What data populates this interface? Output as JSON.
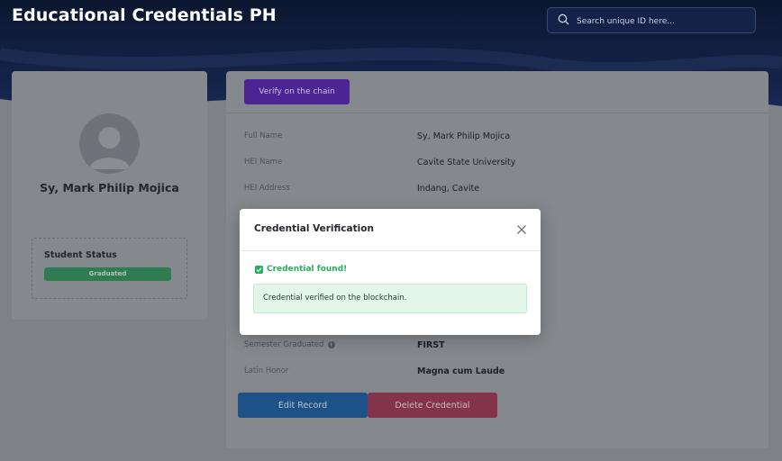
{
  "app": {
    "title": "Educational Credentials PH"
  },
  "search": {
    "placeholder": "Search unique ID here..."
  },
  "profile": {
    "name": "Sy, Mark Philip Mojica",
    "status_label": "Student Status",
    "status_value": "Graduated"
  },
  "actions": {
    "verify_label": "Verify on the chain",
    "edit_label": "Edit Record",
    "delete_label": "Delete Credential"
  },
  "record": {
    "fields": [
      {
        "label": "Full Name",
        "value": "Sy, Mark Philip Mojica"
      },
      {
        "label": "HEI Name",
        "value": "Cavite State University"
      },
      {
        "label": "HEI Address",
        "value": "Indang, Cavite"
      },
      {
        "label": "Semester Graduated",
        "value": "FIRST",
        "has_info_icon": true
      },
      {
        "label": "Latin Honor",
        "value": "Magna cum Laude"
      }
    ]
  },
  "modal": {
    "title": "Credential Verification",
    "found_text": "Credential found!",
    "message": "Credential verified on the blockchain."
  },
  "colors": {
    "primary_purple": "#6f36d6",
    "edit_blue": "#1e7fd8",
    "delete_red": "#d6375f",
    "success_green": "#27ae60",
    "hero_navy": "#0c1730"
  },
  "icons": [
    "search-icon",
    "user-avatar-icon",
    "info-icon",
    "close-icon",
    "check-icon"
  ]
}
